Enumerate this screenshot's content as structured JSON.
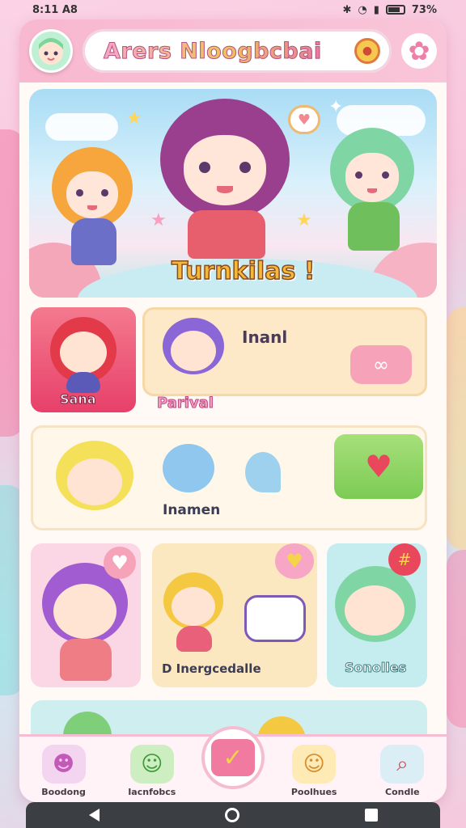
{
  "status_bar": {
    "time": "8:11 A8",
    "right_text": "73%"
  },
  "header": {
    "title": "Arers Nloogbcbai",
    "avatar_icon": "avatar-icon",
    "badge_icon": "medal-icon",
    "settings_icon": "gear-icon"
  },
  "hero": {
    "label": "Turnkilas !"
  },
  "cards": {
    "sana_label": "Sana",
    "inanl_title": "Inanl",
    "inanl_sub": "Parival",
    "inamen_label": "Inamen",
    "middle_label": "D Inergcedalle",
    "sonolies_label": "Sonolles"
  },
  "tabs": [
    {
      "label": "Boodong",
      "icon": "cat-icon"
    },
    {
      "label": "Iacnfobcs",
      "icon": "frog-icon"
    },
    {
      "label": "",
      "icon": "check-icon"
    },
    {
      "label": "Poolhues",
      "icon": "girl-icon"
    },
    {
      "label": "Condle",
      "icon": "search-icon"
    }
  ],
  "colors": {
    "pink_accent": "#f07aa0",
    "header_bg": "#f8b8cf",
    "green_button": "#8fd96a",
    "yellow_card": "#fbe7c0"
  }
}
